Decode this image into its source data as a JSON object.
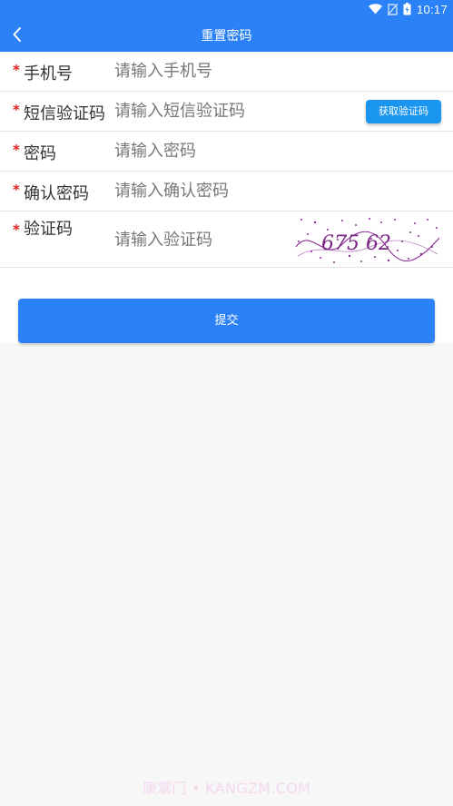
{
  "status_bar": {
    "time": "10:17",
    "icons": [
      "wifi-icon",
      "no-sim-icon",
      "battery-icon"
    ]
  },
  "header": {
    "title": "重置密码",
    "back_icon": "chevron-left-icon"
  },
  "form": {
    "required_mark": "*",
    "phone": {
      "label": "手机号",
      "placeholder": "请输入手机号",
      "value": ""
    },
    "sms_code": {
      "label": "短信验证码",
      "placeholder": "请输入短信验证码",
      "value": "",
      "button_label": "获取验证码"
    },
    "password": {
      "label": "密码",
      "placeholder": "请输入密码",
      "value": ""
    },
    "confirm_password": {
      "label": "确认密码",
      "placeholder": "请输入确认密码",
      "value": ""
    },
    "captcha": {
      "label": "验证码",
      "placeholder": "请输入验证码",
      "value": "",
      "image_text": "675 62"
    }
  },
  "submit_label": "提交",
  "watermark": "康掌门 • KANGZM.COM",
  "colors": {
    "primary": "#2b82f6",
    "sms_button": "#1a96f0",
    "required": "#e02020",
    "captcha_ink": "#8a2a94",
    "page_background": "#f7f7f7"
  }
}
